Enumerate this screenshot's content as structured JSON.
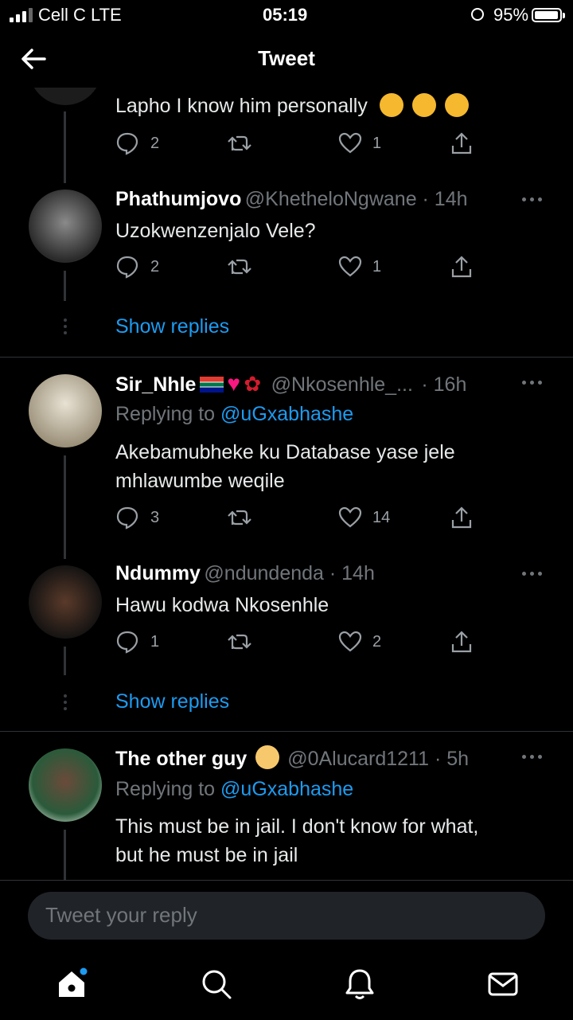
{
  "status_bar": {
    "carrier": "Cell C  LTE",
    "time": "05:19",
    "battery": "95%",
    "battery_level": 0.95
  },
  "header": {
    "title": "Tweet"
  },
  "tweets": [
    {
      "text": "Lapho I know him personally",
      "stats": {
        "replies": "2",
        "likes": "1"
      }
    },
    {
      "name": "Phathumjovo",
      "handle": "@KhetheloNgwane · 14h",
      "text": "Uzokwenzenjalo Vele?",
      "stats": {
        "replies": "2",
        "likes": "1"
      }
    },
    {
      "name": "Sir_Nhle",
      "handle": "@Nkosenhle_...",
      "time": "· 16h",
      "replying_prefix": "Replying to ",
      "replying_user": "@uGxabhashe",
      "text_lines": [
        "Akebamubheke ku Database yase jele",
        "mhlawumbe weqile"
      ],
      "stats": {
        "replies": "3",
        "likes": "14"
      }
    },
    {
      "name": "Ndummy",
      "handle": "@ndundenda · 14h",
      "text": "Hawu kodwa Nkosenhle",
      "stats": {
        "replies": "1",
        "likes": "2"
      }
    },
    {
      "name": "The other guy",
      "handle": "@0Alucard1211 · 5h",
      "replying_prefix": "Replying to ",
      "replying_user": "@uGxabhashe",
      "text_lines": [
        "This must be in jail. I don't know for what,",
        "but he must be in jail"
      ]
    }
  ],
  "show_replies": "Show replies",
  "compose": {
    "placeholder": "Tweet your reply"
  },
  "icons": {
    "reply": "reply-icon",
    "retweet": "retweet-icon",
    "like": "like-icon",
    "share": "share-icon"
  },
  "colors": {
    "accent": "#1d9bf0",
    "background": "#000000"
  }
}
